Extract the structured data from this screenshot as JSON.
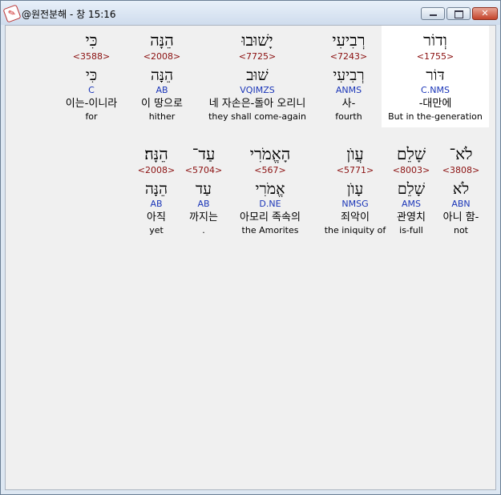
{
  "window": {
    "title": "@원전분해 - 창 15:16",
    "icon": "scroll-app-icon",
    "close_glyph": "✕"
  },
  "rows": [
    {
      "words": [
        {
          "hebrew": "כִּי",
          "strong": "<3588>",
          "lemma": "כִּי",
          "morph": "C",
          "korean": "이는-이니라",
          "english": "for"
        },
        {
          "hebrew": "הֵנָּה",
          "strong": "<2008>",
          "lemma": "הֵנָּה",
          "morph": "AB",
          "korean": "이 땅으로",
          "english": "hither"
        },
        {
          "hebrew": "יָשׁוּבוּ",
          "strong": "<7725>",
          "lemma": "שׁוּב",
          "morph": "VQIMZS",
          "korean": "네 자손은-돌아 오리니",
          "english": "they shall come-again"
        },
        {
          "hebrew": "רְבִיעִי",
          "strong": "<7243>",
          "lemma": "רְבִיעִי",
          "morph": "ANMS",
          "korean": "사-",
          "english": "fourth"
        },
        {
          "hebrew": "וְדוֹר",
          "strong": "<1755>",
          "lemma": "דּוֹר",
          "morph": "C.NMS",
          "korean": "-대만에",
          "english": "But in the-generation",
          "highlighted": true
        }
      ]
    },
    {
      "words": [
        {
          "hebrew": "הֵנָּה׃",
          "strong": "<2008>",
          "lemma": "הֵנָּה",
          "morph": "AB",
          "korean": "아직",
          "english": "yet"
        },
        {
          "hebrew": "עַד־",
          "strong": "<5704>",
          "lemma": "עַד",
          "morph": "AB",
          "korean": "까지는",
          "english": "."
        },
        {
          "hebrew": "הָאֱמֹרִי",
          "strong": "<567>",
          "lemma": "אֱמֹרִי",
          "morph": "D.NE",
          "korean": "아모리 족속의",
          "english": "the Amorites"
        },
        {
          "hebrew": "עֲוֺן",
          "strong": "<5771>",
          "lemma": "עָוֺן",
          "morph": "NMSG",
          "korean": "죄악이",
          "english": "the iniquity of"
        },
        {
          "hebrew": "שָׁלֵם",
          "strong": "<8003>",
          "lemma": "שָׁלֵם",
          "morph": "AMS",
          "korean": "관영치",
          "english": "is-full"
        },
        {
          "hebrew": "לֹא־",
          "strong": "<3808>",
          "lemma": "לֹא",
          "morph": "ABN",
          "korean": "아니 함-",
          "english": "not"
        }
      ]
    }
  ]
}
